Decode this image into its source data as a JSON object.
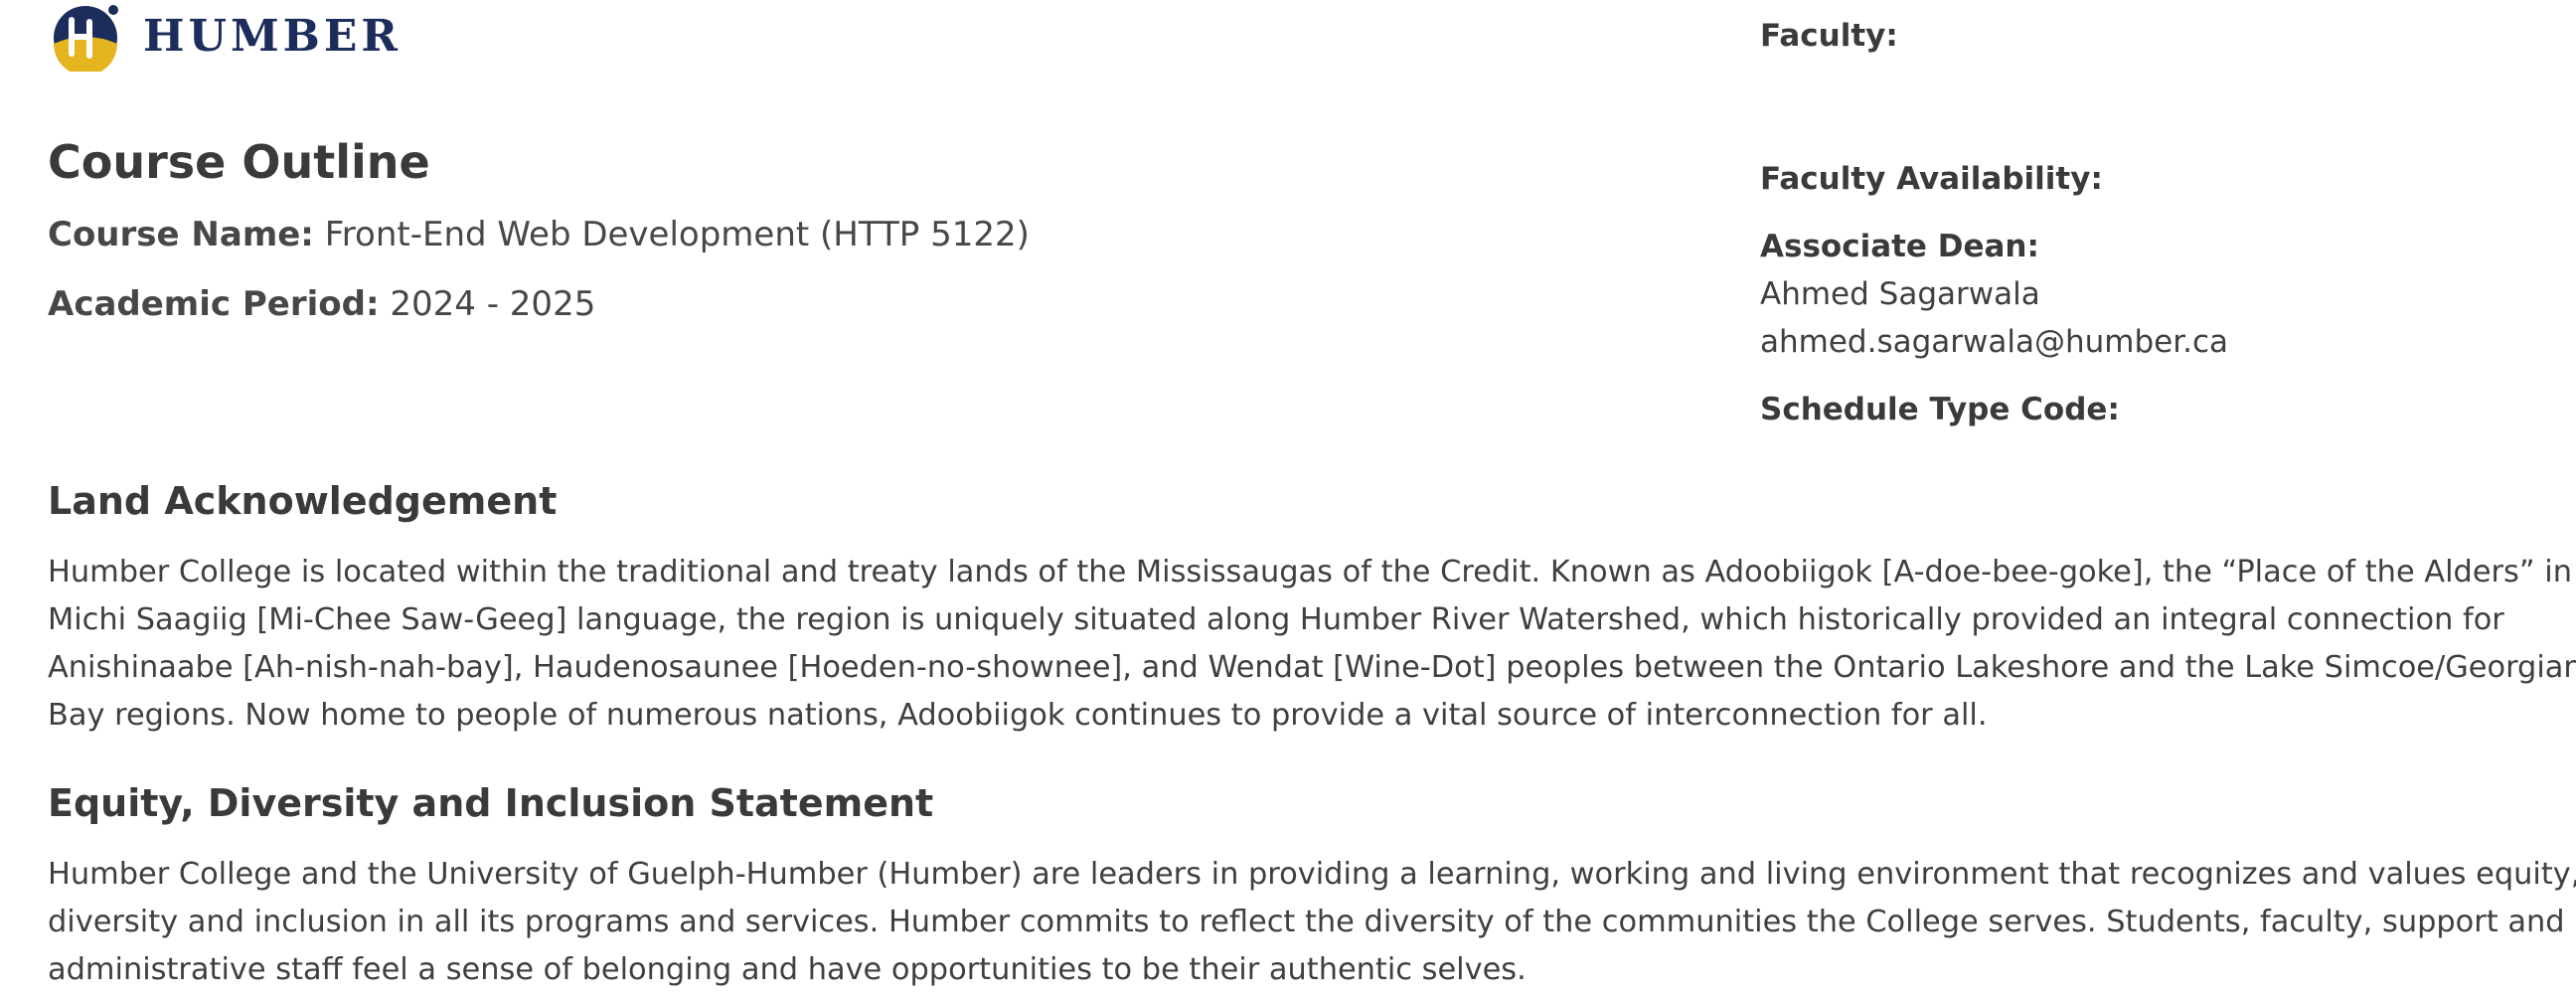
{
  "logo": {
    "wordmark": "HUMBER",
    "icon": "humber-h-logo-icon",
    "colors": {
      "navy": "#1c2d5c",
      "gold": "#e4b51f"
    }
  },
  "header": {
    "title": "Course Outline",
    "course_name_label": "Course Name:",
    "course_name_value": "Front-End Web Development (HTTP 5122)",
    "academic_period_label": "Academic Period:",
    "academic_period_value": "2024 - 2025"
  },
  "info": {
    "faculty_label": "Faculty:",
    "faculty_availability_label": "Faculty Availability:",
    "associate_dean_label": "Associate Dean:",
    "associate_dean_name": "Ahmed Sagarwala",
    "associate_dean_email": "ahmed.sagarwala@humber.ca",
    "schedule_type_code_label": "Schedule Type Code:"
  },
  "land_acknowledgement": {
    "heading": "Land Acknowledgement",
    "lines": [
      "Humber College is located within the traditional and treaty lands of the Mississaugas of the Credit. Known as Adoobiigok [A-doe-bee-goke], the “Place of the Alders” in",
      "Michi Saagiig [Mi-Chee Saw-Geeg] language, the region is uniquely situated along Humber River Watershed, which historically provided an integral connection for",
      "Anishinaabe [Ah-nish-nah-bay], Haudenosaunee [Hoeden-no-shownee], and Wendat [Wine-Dot] peoples between the Ontario Lakeshore and the Lake Simcoe/Georgian",
      "Bay regions. Now home to people of numerous nations, Adoobiigok continues to provide a vital source of interconnection for all."
    ]
  },
  "equity_statement": {
    "heading": "Equity, Diversity and Inclusion Statement",
    "lines": [
      "Humber College and the University of Guelph-Humber (Humber) are leaders in providing a learning, working and living environment that recognizes and values equity,",
      "diversity and inclusion in all its programs and services. Humber commits to reflect the diversity of the communities the College serves. Students, faculty, support and",
      "administrative staff feel a sense of belonging and have opportunities to be their authentic selves."
    ]
  }
}
